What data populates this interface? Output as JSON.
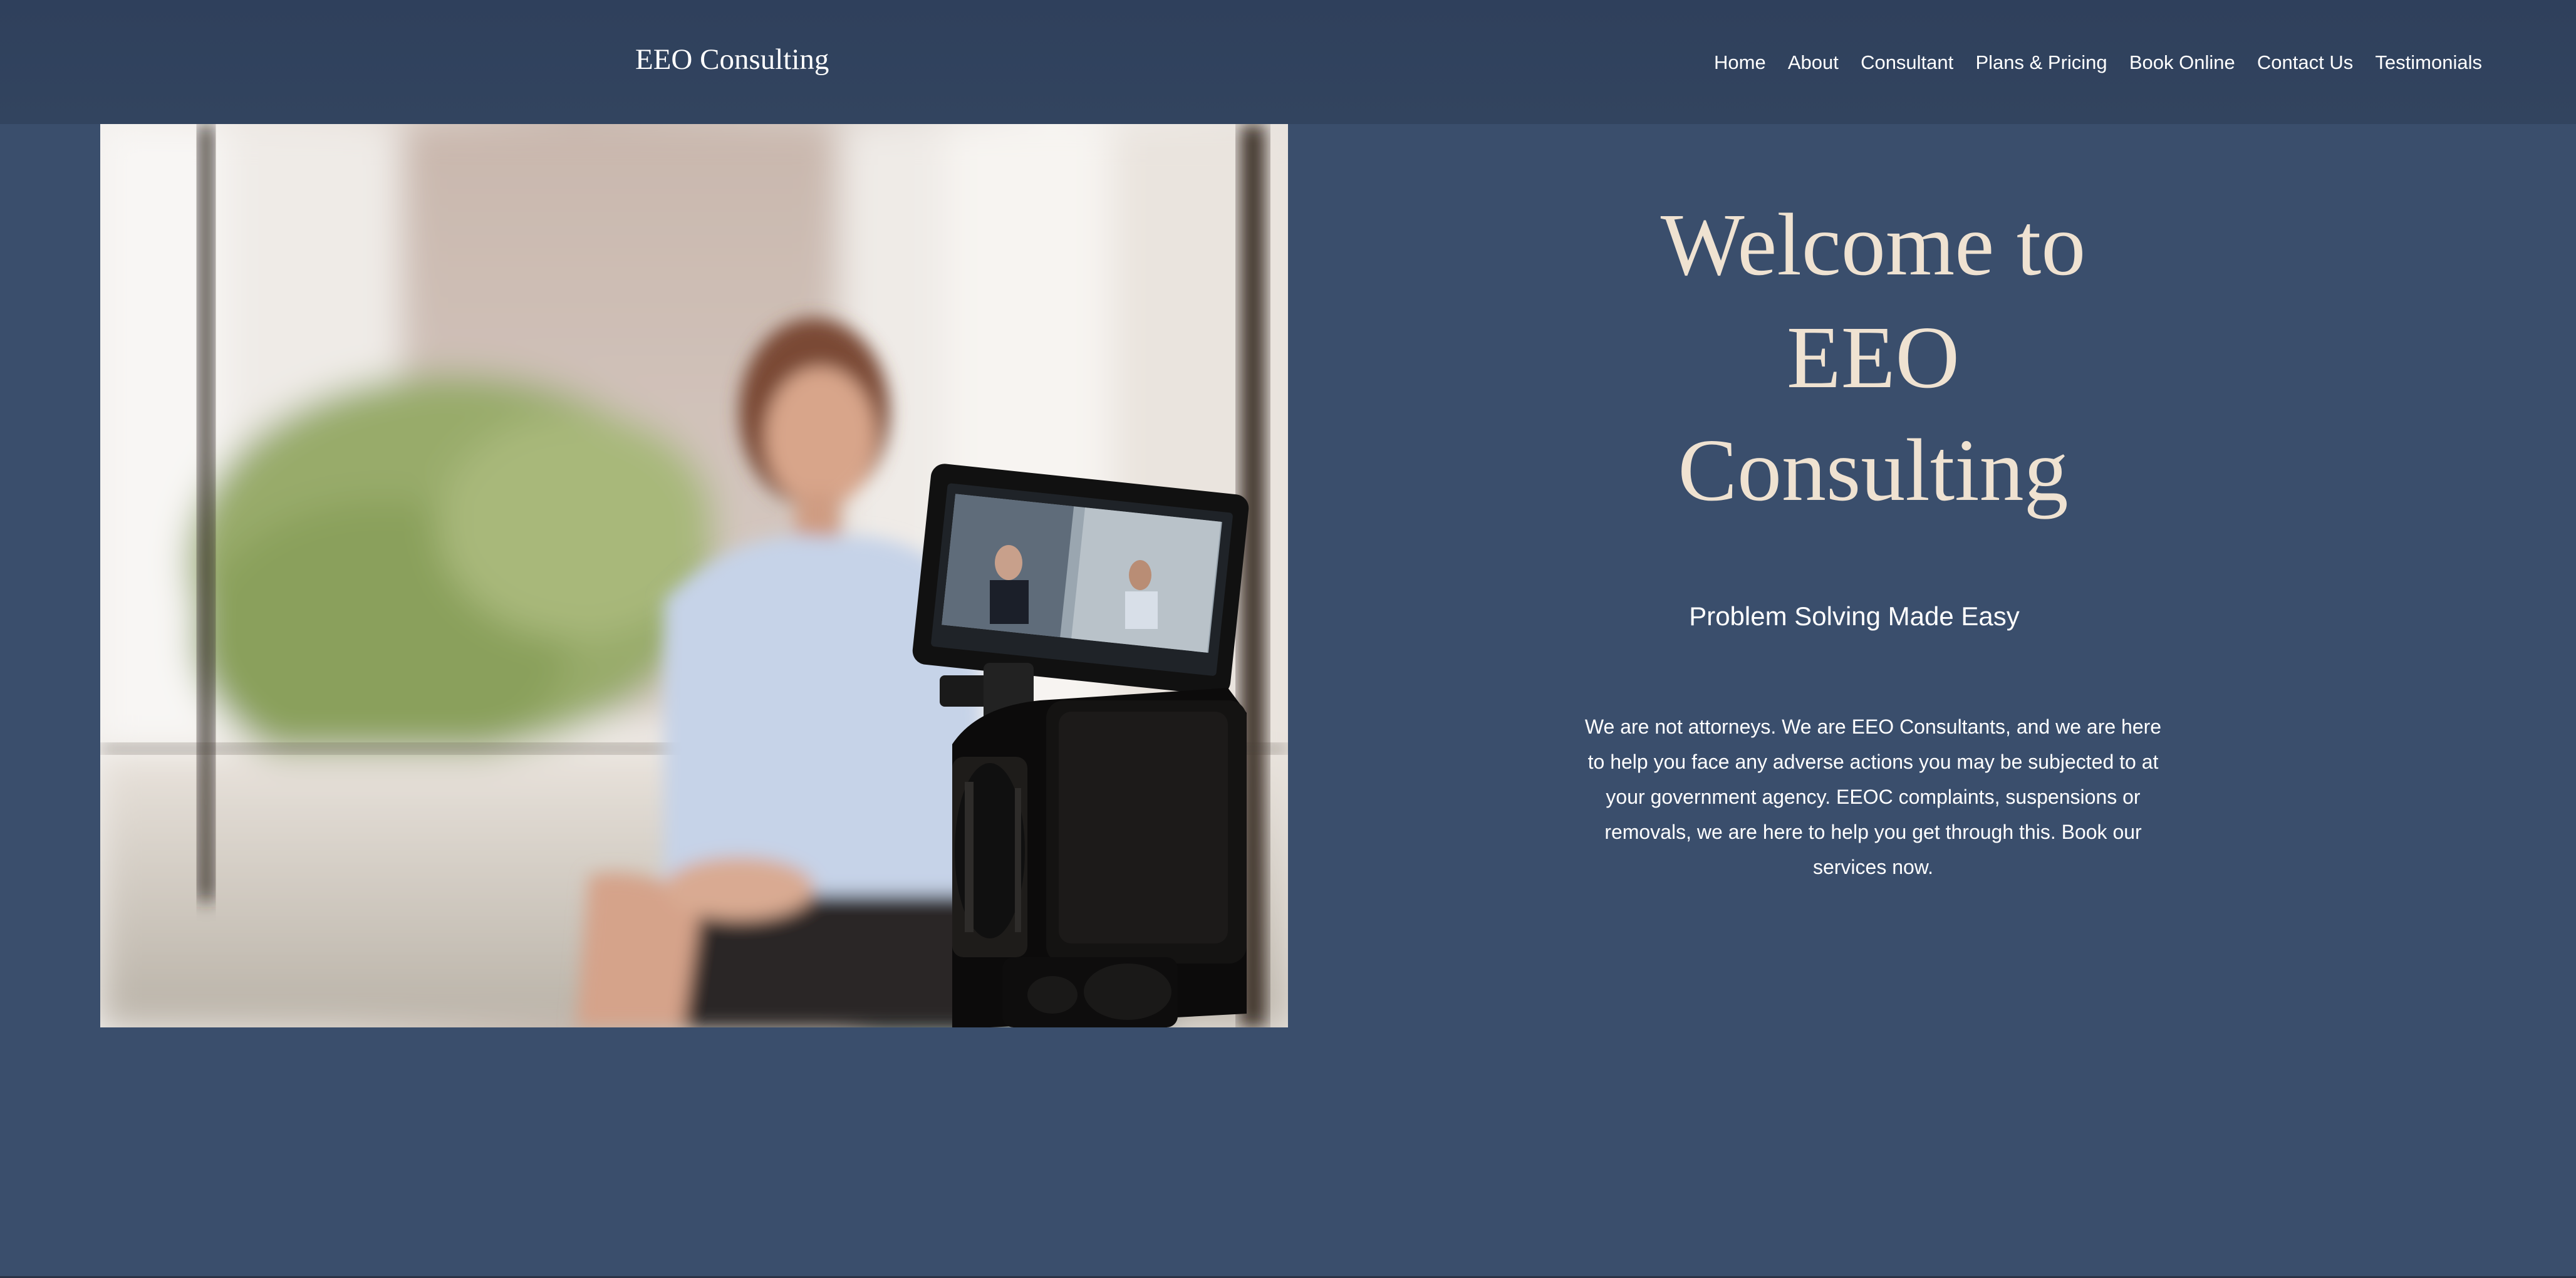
{
  "header": {
    "site_title": "EEO Consulting",
    "nav": [
      {
        "label": "Home"
      },
      {
        "label": "About"
      },
      {
        "label": "Consultant"
      },
      {
        "label": "Plans & Pricing"
      },
      {
        "label": "Book Online"
      },
      {
        "label": "Contact Us"
      },
      {
        "label": "Testimonials"
      }
    ]
  },
  "hero": {
    "welcome_line1": "Welcome to",
    "welcome_line2": "EEO",
    "welcome_line3": "Consulting",
    "tagline": "Problem Solving Made Easy",
    "description": "We are not attorneys.  We are EEO Consultants, and we are here to help you face any adverse actions you may be subjected to at your government agency.  EEOC complaints, suspensions or removals, we are here to help you get through this.  Book our services now."
  },
  "colors": {
    "header_bg": "#2f405c",
    "page_bg": "#3a4e6c",
    "heading_color": "#efe2d1",
    "text_color": "#ffffff"
  }
}
